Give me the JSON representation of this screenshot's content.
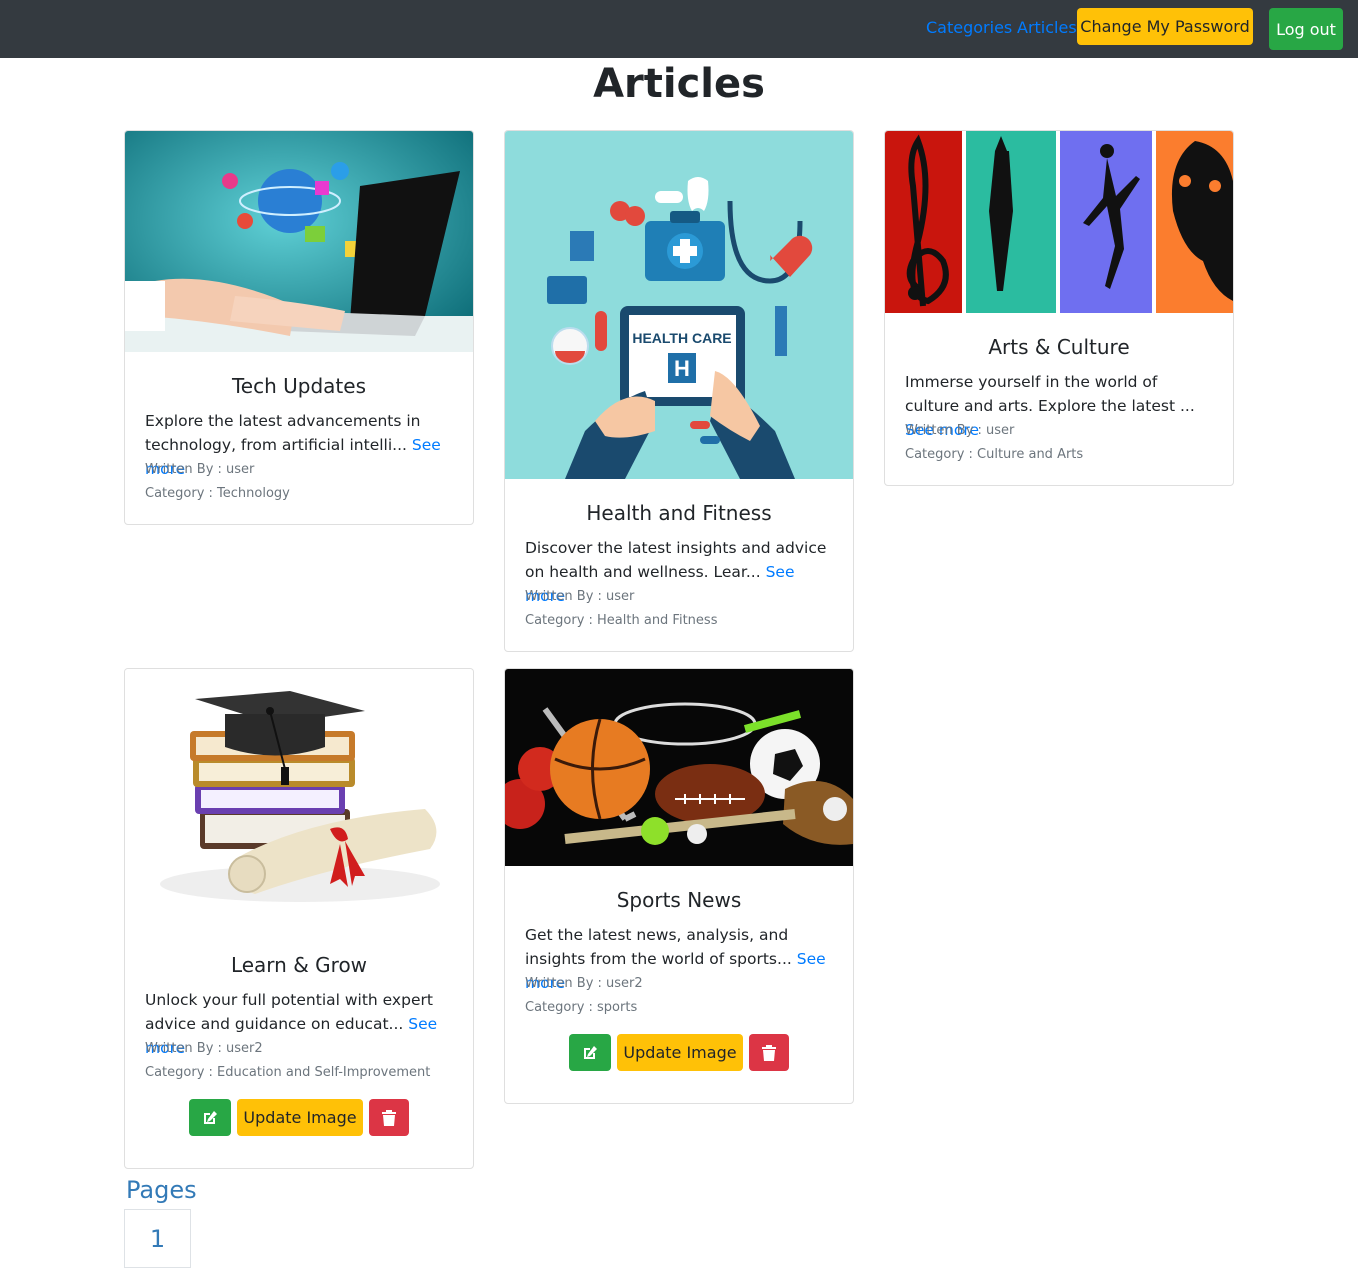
{
  "nav": {
    "categories": "Categories",
    "articles": "Articles",
    "change_password": "Change My Password",
    "logout": "Log out"
  },
  "page_title": "Articles",
  "articles": [
    {
      "title": "Tech Updates",
      "excerpt": "Explore the latest advancements in technology, from artificial intelli...",
      "see_more": "See more",
      "written_by": "Written By : user",
      "category": "Category : Technology"
    },
    {
      "title": "Health and Fitness",
      "excerpt": "Discover the latest insights and advice on health and wellness. Lear...",
      "see_more": "See more",
      "written_by": "Written By : user",
      "category": "Category : Health and Fitness",
      "image_text": "HEALTH CARE"
    },
    {
      "title": "Arts & Culture",
      "excerpt": "Immerse yourself in the world of culture and arts. Explore the latest ...",
      "see_more": "See more",
      "written_by": "Written By : user",
      "category": "Category : Culture and Arts"
    },
    {
      "title": "Learn & Grow",
      "excerpt": "Unlock your full potential with expert advice and guidance on educat...",
      "see_more": "See more",
      "written_by": "Written By : user2",
      "category": "Category : Education and Self-Improvement",
      "update_image": "Update Image"
    },
    {
      "title": "Sports News",
      "excerpt": "Get the latest news, analysis, and insights from the world of sports...",
      "see_more": "See more",
      "written_by": "Written By : user2",
      "category": "Category : sports",
      "update_image": "Update Image"
    }
  ],
  "pagination": {
    "label": "Pages",
    "pages": [
      "1"
    ]
  },
  "colors": {
    "navbar": "#343a40",
    "link": "#007bff",
    "warning": "#ffc107",
    "success": "#28a745",
    "danger": "#dc3545",
    "pagination": "#337ab7"
  },
  "icons": {
    "edit": "edit-icon",
    "delete": "trash-icon"
  }
}
